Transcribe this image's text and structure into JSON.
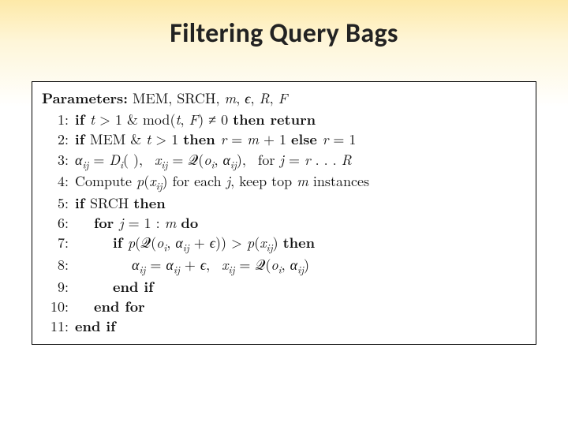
{
  "title": "Filtering Query Bags",
  "params_label": "Parameters:",
  "params_list": "MEM, SRCH, m, ϵ, R, F",
  "lines": {
    "l1": {
      "n": "1:",
      "txt_a": "if ",
      "txt_b": "t > 1 & mod(t, F) ≠ 0 ",
      "txt_c": "then return"
    },
    "l2": {
      "n": "2:",
      "txt_a": "if ",
      "txt_b": "MEM & t > 1 ",
      "txt_c": "then ",
      "txt_d": "r = m + 1 ",
      "txt_e": "else ",
      "txt_f": "r = 1"
    },
    "l3": {
      "n": "3:",
      "txt": "αij = Di( ), xij = Q(oi, αij), for j = r . . . R"
    },
    "l4": {
      "n": "4:",
      "txt_a": "Compute ",
      "txt_b": "p(xij) ",
      "txt_c": "for each ",
      "txt_d": "j, ",
      "txt_e": "keep top ",
      "txt_f": "m ",
      "txt_g": "instances"
    },
    "l5": {
      "n": "5:",
      "txt_a": "if ",
      "txt_b": "SRCH ",
      "txt_c": "then"
    },
    "l6": {
      "n": "6:",
      "txt_a": "for ",
      "txt_b": "j = 1 : m ",
      "txt_c": "do"
    },
    "l7": {
      "n": "7:",
      "txt_a": "if ",
      "txt_b": "p(Q(oi, αij + ϵ)) > p(xij) ",
      "txt_c": "then"
    },
    "l8": {
      "n": "8:",
      "txt": "αij = αij + ϵ, xij = Q(oi, αij)"
    },
    "l9": {
      "n": "9:",
      "txt": "end if"
    },
    "l10": {
      "n": "10:",
      "txt": "end for"
    },
    "l11": {
      "n": "11:",
      "txt": "end if"
    }
  }
}
